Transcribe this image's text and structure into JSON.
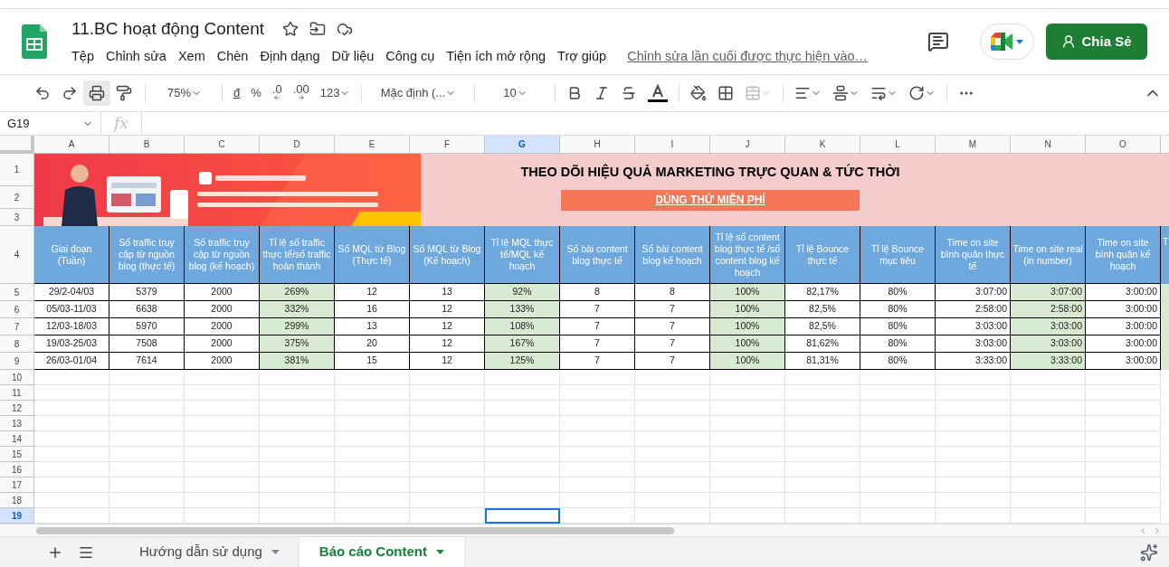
{
  "document": {
    "title": "11.BC hoạt động Content"
  },
  "menu": [
    "Tệp",
    "Chỉnh sửa",
    "Xem",
    "Chèn",
    "Định dạng",
    "Dữ liệu",
    "Công cụ",
    "Tiện ích mở rộng",
    "Trợ giúp"
  ],
  "last_edit": "Chỉnh sửa lần cuối được thực hiện vào…",
  "share_button": "Chia Sẻ",
  "toolbar": {
    "zoom": "75%",
    "currency": "đ",
    "percent": "%",
    "decrease_decimal": ".0",
    "increase_decimal": ".00",
    "number_format": "123",
    "font": "Mặc định (...",
    "font_size": "10"
  },
  "formula_bar": {
    "cell": "G19",
    "fx": "fx"
  },
  "columns": [
    {
      "letter": "A",
      "selected": false
    },
    {
      "letter": "B",
      "selected": false
    },
    {
      "letter": "C",
      "selected": false
    },
    {
      "letter": "D",
      "selected": false
    },
    {
      "letter": "E",
      "selected": false
    },
    {
      "letter": "F",
      "selected": false
    },
    {
      "letter": "G",
      "selected": true
    },
    {
      "letter": "H",
      "selected": false
    },
    {
      "letter": "I",
      "selected": false
    },
    {
      "letter": "J",
      "selected": false
    },
    {
      "letter": "K",
      "selected": false
    },
    {
      "letter": "L",
      "selected": false
    },
    {
      "letter": "M",
      "selected": false
    },
    {
      "letter": "N",
      "selected": false
    },
    {
      "letter": "O",
      "selected": false
    }
  ],
  "row_numbers": [
    {
      "label": "1",
      "selected": false
    },
    {
      "label": "2",
      "selected": false
    },
    {
      "label": "3",
      "selected": false
    },
    {
      "label": "4",
      "selected": false
    },
    {
      "label": "5",
      "selected": false
    },
    {
      "label": "6",
      "selected": false
    },
    {
      "label": "7",
      "selected": false
    },
    {
      "label": "8",
      "selected": false
    },
    {
      "label": "9",
      "selected": false
    },
    {
      "label": "10",
      "selected": false
    },
    {
      "label": "11",
      "selected": false
    },
    {
      "label": "12",
      "selected": false
    },
    {
      "label": "13",
      "selected": false
    },
    {
      "label": "14",
      "selected": false
    },
    {
      "label": "15",
      "selected": false
    },
    {
      "label": "16",
      "selected": false
    },
    {
      "label": "17",
      "selected": false
    },
    {
      "label": "18",
      "selected": false
    },
    {
      "label": "19",
      "selected": true
    }
  ],
  "banner": {
    "kind": "picture",
    "heading": "THEO DÕI HIỆU QUẢ MARKETING TRỰC QUAN & TỨC THỜI",
    "link": "DÙNG THỬ MIỄN PHÍ"
  },
  "table": {
    "headers": [
      {
        "text": "Giai đoạn (Tuần)",
        "shaded": false
      },
      {
        "text": "Số traffic truy cập từ nguồn blog (thực tế)",
        "shaded": false
      },
      {
        "text": "Số traffic truy cập từ nguồn blog (kế hoạch)",
        "shaded": false
      },
      {
        "text": "Tỉ lệ số traffic thực tế/số traffic hoàn thành",
        "shaded": true
      },
      {
        "text": "Số MQL từ Blog (Thực tế)",
        "shaded": false
      },
      {
        "text": "Số MQL từ Blog (Kế hoạch)",
        "shaded": false
      },
      {
        "text": "Tỉ lệ MQL thực tế/MQL kế hoạch",
        "shaded": true
      },
      {
        "text": "Số bài content blog thực tế",
        "shaded": false
      },
      {
        "text": "Số bài content blog kế hoạch",
        "shaded": false
      },
      {
        "text": "Tỉ lệ số content blog thực tế /số content blog kế hoạch",
        "shaded": true
      },
      {
        "text": "Tỉ lệ Bounce thực tế",
        "shaded": false
      },
      {
        "text": "Tỉ lệ Bounce mục tiêu",
        "shaded": false
      },
      {
        "text": "Time on site bình quân thực tế",
        "shaded": false
      },
      {
        "text": "Time on site real (in number)",
        "shaded": true
      },
      {
        "text": "Time on site bình quân kế hoạch",
        "shaded": false
      }
    ],
    "cut_header": "T",
    "rows": [
      [
        "29/2-04/03",
        "5379",
        "2000",
        "269%",
        "12",
        "13",
        "92%",
        "8",
        "8",
        "100%",
        "82,17%",
        "80%",
        "3:07:00",
        "3:07:00",
        "3:00:00"
      ],
      [
        "05/03-11/03",
        "6638",
        "2000",
        "332%",
        "16",
        "12",
        "133%",
        "7",
        "7",
        "100%",
        "82,5%",
        "80%",
        "2:58:00",
        "2:58:00",
        "3:00:00"
      ],
      [
        "12/03-18/03",
        "5970",
        "2000",
        "299%",
        "13",
        "12",
        "108%",
        "7",
        "7",
        "100%",
        "82,5%",
        "80%",
        "3:03:00",
        "3:03:00",
        "3:00:00"
      ],
      [
        "19/03-25/03",
        "7508",
        "2000",
        "375%",
        "20",
        "12",
        "167%",
        "7",
        "7",
        "100%",
        "81,62%",
        "80%",
        "3:03:00",
        "3:03:00",
        "3:00:00"
      ],
      [
        "26/03-01/04",
        "7614",
        "2000",
        "381%",
        "15",
        "12",
        "125%",
        "7",
        "7",
        "100%",
        "81,31%",
        "80%",
        "3:33:00",
        "3:33:00",
        "3:00:00"
      ]
    ]
  },
  "sheets": [
    {
      "name": "Hướng dẫn sử dụng",
      "selected": false
    },
    {
      "name": "Báo cáo Content",
      "selected": true
    }
  ]
}
